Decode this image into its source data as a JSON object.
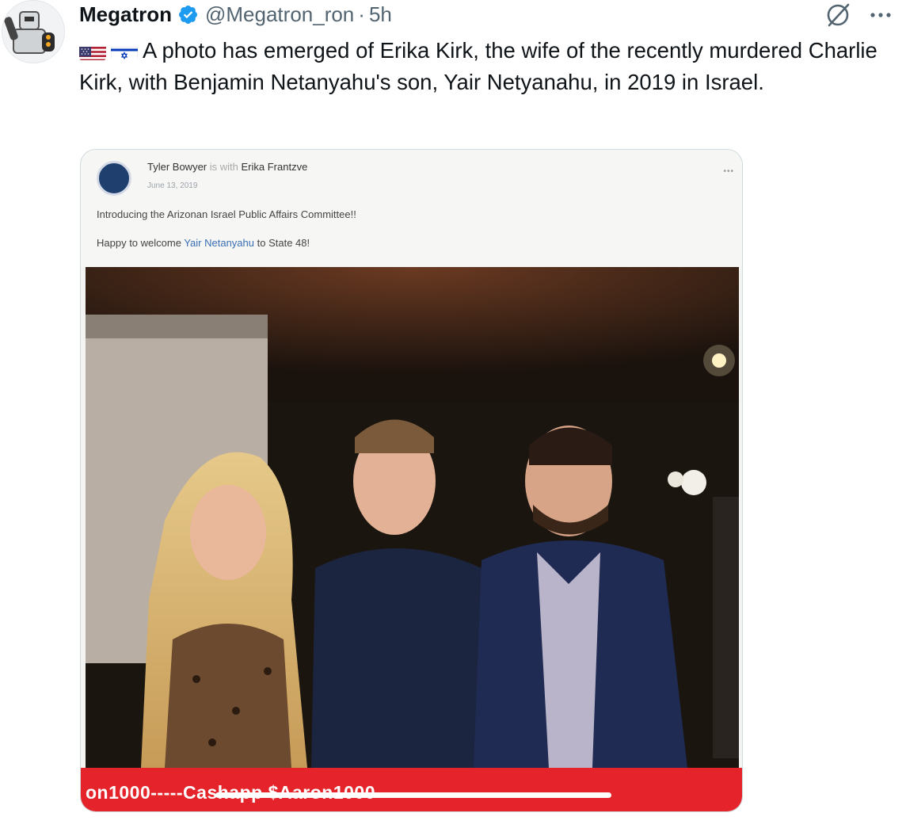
{
  "author": {
    "display_name": "Megatron",
    "handle": "@Megatron_ron",
    "separator": "·",
    "time_ago": "5h",
    "verified": true
  },
  "icons": {
    "avatar": "robot-avatar-icon",
    "verified": "verified-badge-icon",
    "grok": "grok-icon",
    "more": "more-options-icon",
    "flag_us": "us-flag-icon",
    "flag_il": "israel-flag-icon"
  },
  "tweet": {
    "text": "A photo has emerged of Erika Kirk, the wife of the recently murdered Charlie Kirk, with Benjamin Netanyahu's son, Yair Netyanahu, in 2019 in Israel."
  },
  "embedded_post": {
    "poster": "Tyler Bowyer",
    "with_label": "is with",
    "tagged": "Erika Frantzve",
    "date": "June 13, 2019",
    "line1": "Introducing the Arizonan Israel Public Affairs Committee!!",
    "line2_prefix": "Happy to welcome",
    "line2_link": "Yair Netanyahu",
    "line2_suffix": "to State 48!",
    "banner_text": "on1000-----Cashapp $Aaron1000"
  },
  "colors": {
    "verified_blue": "#1d9bf0",
    "text_primary": "#0f1419",
    "text_secondary": "#536471",
    "banner_red": "#e4242a"
  }
}
